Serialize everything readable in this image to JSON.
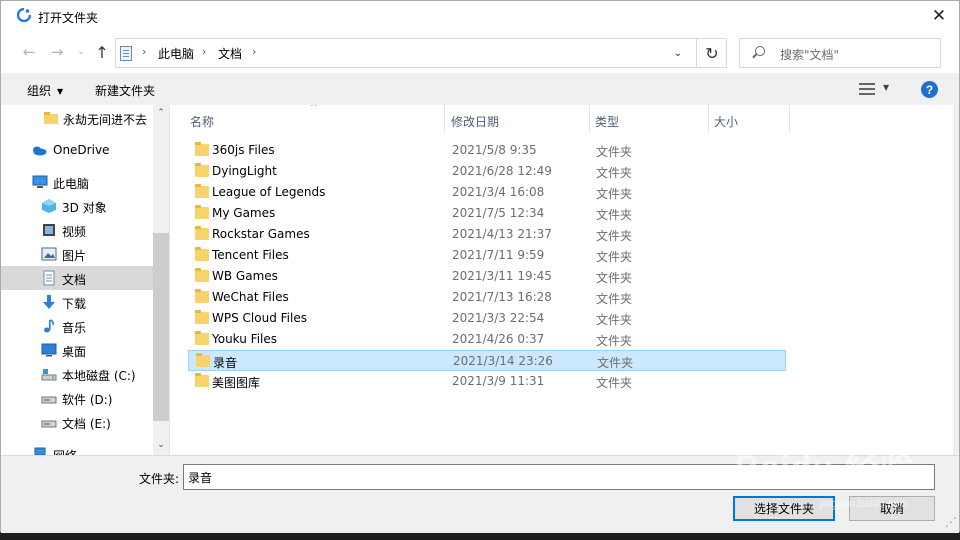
{
  "window": {
    "title": "打开文件夹",
    "close_glyph": "✕"
  },
  "nav_buttons": {
    "back": "←",
    "forward": "→",
    "recent_dropdown": "⌄",
    "up": "↑"
  },
  "address": {
    "crumbs": [
      "此电脑",
      "文档"
    ],
    "separator": "›",
    "dropdown_glyph": "⌄",
    "refresh_glyph": "↻"
  },
  "search": {
    "placeholder": "搜索\"文档\""
  },
  "toolbar": {
    "organize_label": "组织",
    "organize_caret": "▼",
    "new_folder_label": "新建文件夹",
    "view_caret": "▼",
    "help_glyph": "?"
  },
  "nav_pane": {
    "items": [
      {
        "label": "永劫无间进不去",
        "icon": "folder-icon"
      },
      {
        "label": "OneDrive",
        "icon": "onedrive-icon"
      },
      {
        "label": "此电脑",
        "icon": "this-pc-icon"
      },
      {
        "label": "3D 对象",
        "icon": "3d-objects-icon"
      },
      {
        "label": "视频",
        "icon": "videos-icon"
      },
      {
        "label": "图片",
        "icon": "pictures-icon"
      },
      {
        "label": "文档",
        "icon": "documents-icon",
        "selected": true
      },
      {
        "label": "下载",
        "icon": "downloads-icon"
      },
      {
        "label": "音乐",
        "icon": "music-icon"
      },
      {
        "label": "桌面",
        "icon": "desktop-icon"
      },
      {
        "label": "本地磁盘 (C:)",
        "icon": "local-disk-icon"
      },
      {
        "label": "软件 (D:)",
        "icon": "drive-icon"
      },
      {
        "label": "文档 (E:)",
        "icon": "drive-icon"
      },
      {
        "label": "网络",
        "icon": "network-icon"
      }
    ],
    "scroll_up": "⌃",
    "scroll_down": "⌄"
  },
  "columns": {
    "name": "名称",
    "modified": "修改日期",
    "type": "类型",
    "size": "大小",
    "sort_indicator": "^"
  },
  "files": [
    {
      "name": "360js Files",
      "modified": "2021/5/8 9:35",
      "type": "文件夹"
    },
    {
      "name": "DyingLight",
      "modified": "2021/6/28 12:49",
      "type": "文件夹"
    },
    {
      "name": "League of Legends",
      "modified": "2021/3/4 16:08",
      "type": "文件夹"
    },
    {
      "name": "My Games",
      "modified": "2021/7/5 12:34",
      "type": "文件夹"
    },
    {
      "name": "Rockstar Games",
      "modified": "2021/4/13 21:37",
      "type": "文件夹"
    },
    {
      "name": "Tencent Files",
      "modified": "2021/7/11 9:59",
      "type": "文件夹"
    },
    {
      "name": "WB Games",
      "modified": "2021/3/11 19:45",
      "type": "文件夹"
    },
    {
      "name": "WeChat Files",
      "modified": "2021/7/13 16:28",
      "type": "文件夹"
    },
    {
      "name": "WPS Cloud Files",
      "modified": "2021/3/3 22:54",
      "type": "文件夹"
    },
    {
      "name": "Youku Files",
      "modified": "2021/4/26 0:37",
      "type": "文件夹"
    },
    {
      "name": "录音",
      "modified": "2021/3/14 23:26",
      "type": "文件夹",
      "selected": true
    },
    {
      "name": "美图图库",
      "modified": "2021/3/9 11:31",
      "type": "文件夹"
    }
  ],
  "bottom": {
    "folder_label": "文件夹:",
    "folder_value": "录音",
    "select_button": "选择文件夹",
    "cancel_button": "取消"
  },
  "watermark": {
    "text": "Baidu 经验",
    "sub": "jingyan.baidu.com"
  },
  "colors": {
    "selection_bg": "#cce8ff",
    "selection_border": "#99d1ff",
    "accent": "#0078d7",
    "folder_yellow": "#f7d36a"
  }
}
